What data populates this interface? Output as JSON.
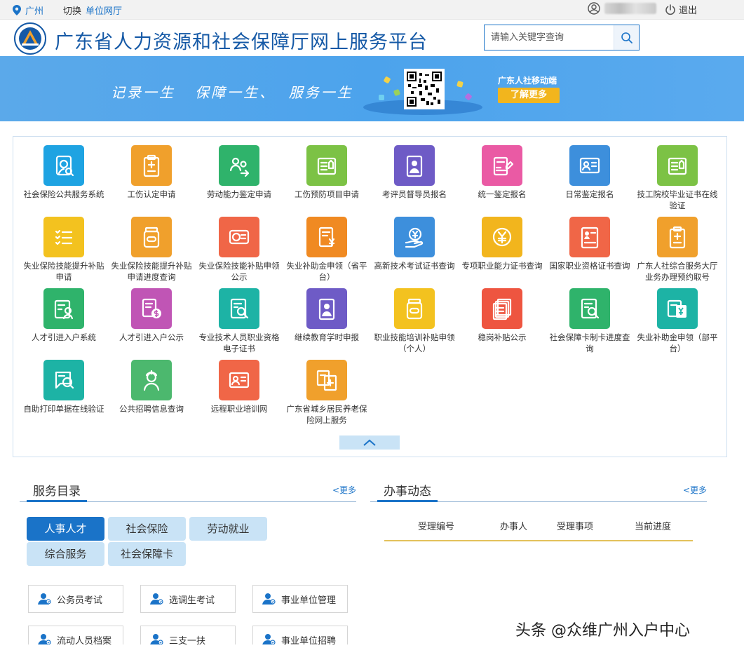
{
  "topbar": {
    "city": "广州",
    "switch_label": "切换",
    "switch_link": "单位网厅",
    "logout": "退出"
  },
  "header": {
    "title": "广东省人力资源和社会保障厅网上服务平台",
    "search_placeholder": "请输入关键字查询"
  },
  "banner": {
    "slogan": "记录一生   保障一生、  服务一生",
    "mobile_label": "广东人社移动端",
    "more_button": "了解更多"
  },
  "services": [
    {
      "label": "社会保险公共服务系统",
      "color": "#1ea3e2",
      "icon": "search-user-icon"
    },
    {
      "label": "工伤认定申请",
      "color": "#f0a02c",
      "icon": "clipboard-plus-icon"
    },
    {
      "label": "劳动能力鉴定申请",
      "color": "#2fb36b",
      "icon": "people-exchange-icon"
    },
    {
      "label": "工伤预防项目申请",
      "color": "#7cc245",
      "icon": "certificate-icon"
    },
    {
      "label": "考评员督导员报名",
      "color": "#6e5bc6",
      "icon": "person-badge-icon"
    },
    {
      "label": "统一鉴定报名",
      "color": "#ea5aa4",
      "icon": "bed-edit-icon"
    },
    {
      "label": "日常鉴定报名",
      "color": "#3d8fdc",
      "icon": "id-card-icon"
    },
    {
      "label": "技工院校毕业证书在线验证",
      "color": "#7cc245",
      "icon": "certificate-icon"
    },
    {
      "label": "失业保险技能提升补贴申请",
      "color": "#f3c21f",
      "icon": "checklist-icon"
    },
    {
      "label": "失业保险技能提升补贴申请进度查询",
      "color": "#f0a02c",
      "icon": "medicine-jar-icon"
    },
    {
      "label": "失业保险技能补贴申领公示",
      "color": "#f06647",
      "icon": "card-si-icon"
    },
    {
      "label": "失业补助金申领（省平台）",
      "color": "#f08a22",
      "icon": "yuan-document-icon"
    },
    {
      "label": "高新技术考试证书查询",
      "color": "#3d8fdc",
      "icon": "yuan-hand-icon"
    },
    {
      "label": "专项职业能力证书查询",
      "color": "#f2b51d",
      "icon": "yuan-coin-icon"
    },
    {
      "label": "国家职业资格证书查询",
      "color": "#f06647",
      "icon": "profile-doc-icon"
    },
    {
      "label": "广东人社综合服务大厅业务办理预约取号",
      "color": "#f0a02c",
      "icon": "clipboard-plus-icon"
    },
    {
      "label": "人才引进入户系统",
      "color": "#2fb36b",
      "icon": "person-doc-icon"
    },
    {
      "label": "人才引进入户公示",
      "color": "#c055b5",
      "icon": "dollar-doc-icon"
    },
    {
      "label": "专业技术人员职业资格电子证书",
      "color": "#1db3a5",
      "icon": "search-doc-icon"
    },
    {
      "label": "继续教育学时申报",
      "color": "#6e5bc6",
      "icon": "person-badge-icon"
    },
    {
      "label": "职业技能培训补贴申领（个人）",
      "color": "#f3c21f",
      "icon": "medicine-jar-icon"
    },
    {
      "label": "稳岗补贴公示",
      "color": "#ee5540",
      "icon": "stacked-docs-icon"
    },
    {
      "label": "社会保障卡制卡进度查询",
      "color": "#2fb36b",
      "icon": "search-doc-icon"
    },
    {
      "label": "失业补助金申领（部平台）",
      "color": "#1db3a5",
      "icon": "yuan-cards-icon"
    },
    {
      "label": "自助打印单据在线验证",
      "color": "#1db3a5",
      "icon": "search-si-icon"
    },
    {
      "label": "公共招聘信息查询",
      "color": "#4cb86e",
      "icon": "nurse-icon"
    },
    {
      "label": "远程职业培训网",
      "color": "#f06647",
      "icon": "id-card-icon"
    },
    {
      "label": "广东省城乡居民养老保险网上服务",
      "color": "#f0a02c",
      "icon": "medical-docs-icon"
    }
  ],
  "catalog": {
    "title": "服务目录",
    "more": "<更多",
    "categories": [
      "人事人才",
      "社会保险",
      "劳动就业",
      "综合服务",
      "社会保障卡"
    ],
    "items": [
      "公务员考试",
      "选调生考试",
      "事业单位管理",
      "流动人员档案",
      "三支一扶",
      "事业单位招聘"
    ]
  },
  "activity": {
    "title": "办事动态",
    "more": "<更多",
    "columns": [
      "受理编号",
      "办事人",
      "受理事项",
      "当前进度"
    ]
  },
  "watermark": "头条 @众维广州入户中心"
}
